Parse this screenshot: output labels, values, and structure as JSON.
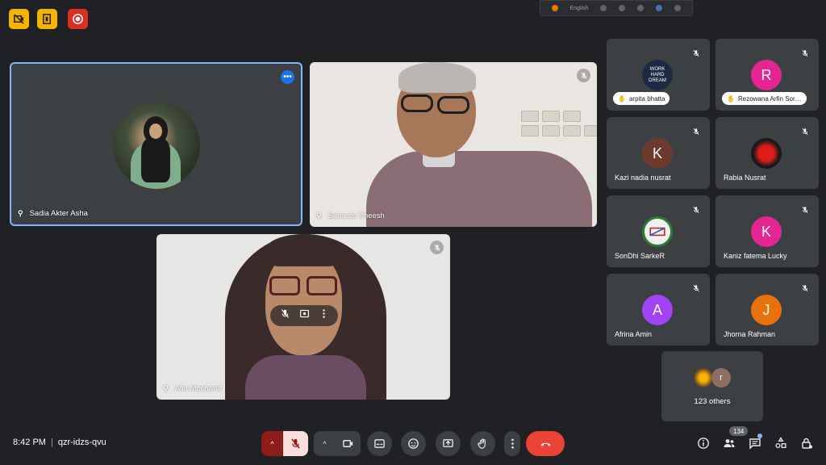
{
  "meeting": {
    "time": "8:42 PM",
    "separator": "|",
    "code": "qzr-idzs-qvu"
  },
  "participant_count": "134",
  "language_toolbar": {
    "language": "English"
  },
  "main_tiles": [
    {
      "name": "Sadia Akter Asha",
      "muted": false
    },
    {
      "name": "Sameeo Sheesh",
      "muted": true
    },
    {
      "name": "Afia Mosharat",
      "muted": true
    }
  ],
  "side_tiles": [
    {
      "name": "arpita bhatta",
      "avatar_type": "image",
      "chip": true,
      "color": "#1d2a44"
    },
    {
      "name": "Rezowana Arfin Sor…",
      "avatar_letter": "R",
      "chip": true,
      "color": "#e52592"
    },
    {
      "name": "Kazi nadia nusrat",
      "avatar_letter": "K",
      "color": "#6d3b2e"
    },
    {
      "name": "Rabia Nusrat",
      "avatar_type": "image",
      "color": "#a50e0e"
    },
    {
      "name": "SonDhi SarkeR",
      "avatar_type": "image",
      "color": "#e8e8e8"
    },
    {
      "name": "Kaniz fatema Lucky",
      "avatar_letter": "K",
      "color": "#e52592"
    },
    {
      "name": "Afrina Amin",
      "avatar_letter": "A",
      "color": "#a142f4"
    },
    {
      "name": "Jhorna Rahman",
      "avatar_letter": "J",
      "color": "#e8710a"
    }
  ],
  "others": {
    "label": "123 others",
    "mini_letter": "r"
  },
  "colors": {
    "background": "#202124",
    "tile": "#3c4043",
    "accent": "#8ab4f8",
    "end_call": "#ea4335",
    "mic_off": "#f28b82"
  }
}
